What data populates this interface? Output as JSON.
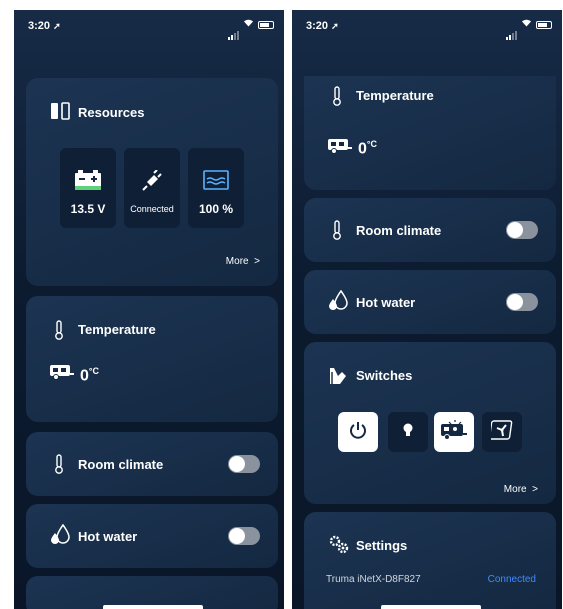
{
  "status_bar": {
    "time": "3:20",
    "location_glyph": "➚"
  },
  "resources": {
    "title": "Resources",
    "battery_value": "13.5 V",
    "power_value": "Connected",
    "water_value": "100 %",
    "more_label": "More",
    "more_chevron": ">"
  },
  "temperature": {
    "title": "Temperature",
    "value": "0",
    "unit": "°C"
  },
  "room_climate": {
    "title": "Room climate",
    "on": false
  },
  "hot_water": {
    "title": "Hot water",
    "on": false
  },
  "switches": {
    "title": "Switches",
    "more_label": "More",
    "more_chevron": ">",
    "items": [
      {
        "icon": "power-icon",
        "active": true
      },
      {
        "icon": "bulb-icon",
        "active": false
      },
      {
        "icon": "caravan-light-icon",
        "active": true
      },
      {
        "icon": "fan-icon",
        "active": false
      }
    ]
  },
  "settings": {
    "title": "Settings",
    "device_name": "Truma iNetX-D8F827",
    "connection_status": "Connected"
  },
  "colors": {
    "accent": "#3d8bff",
    "card": "#1c3452",
    "background": "#0c1b30",
    "battery_green": "#5fd17a",
    "water_blue": "#59b3ff"
  }
}
